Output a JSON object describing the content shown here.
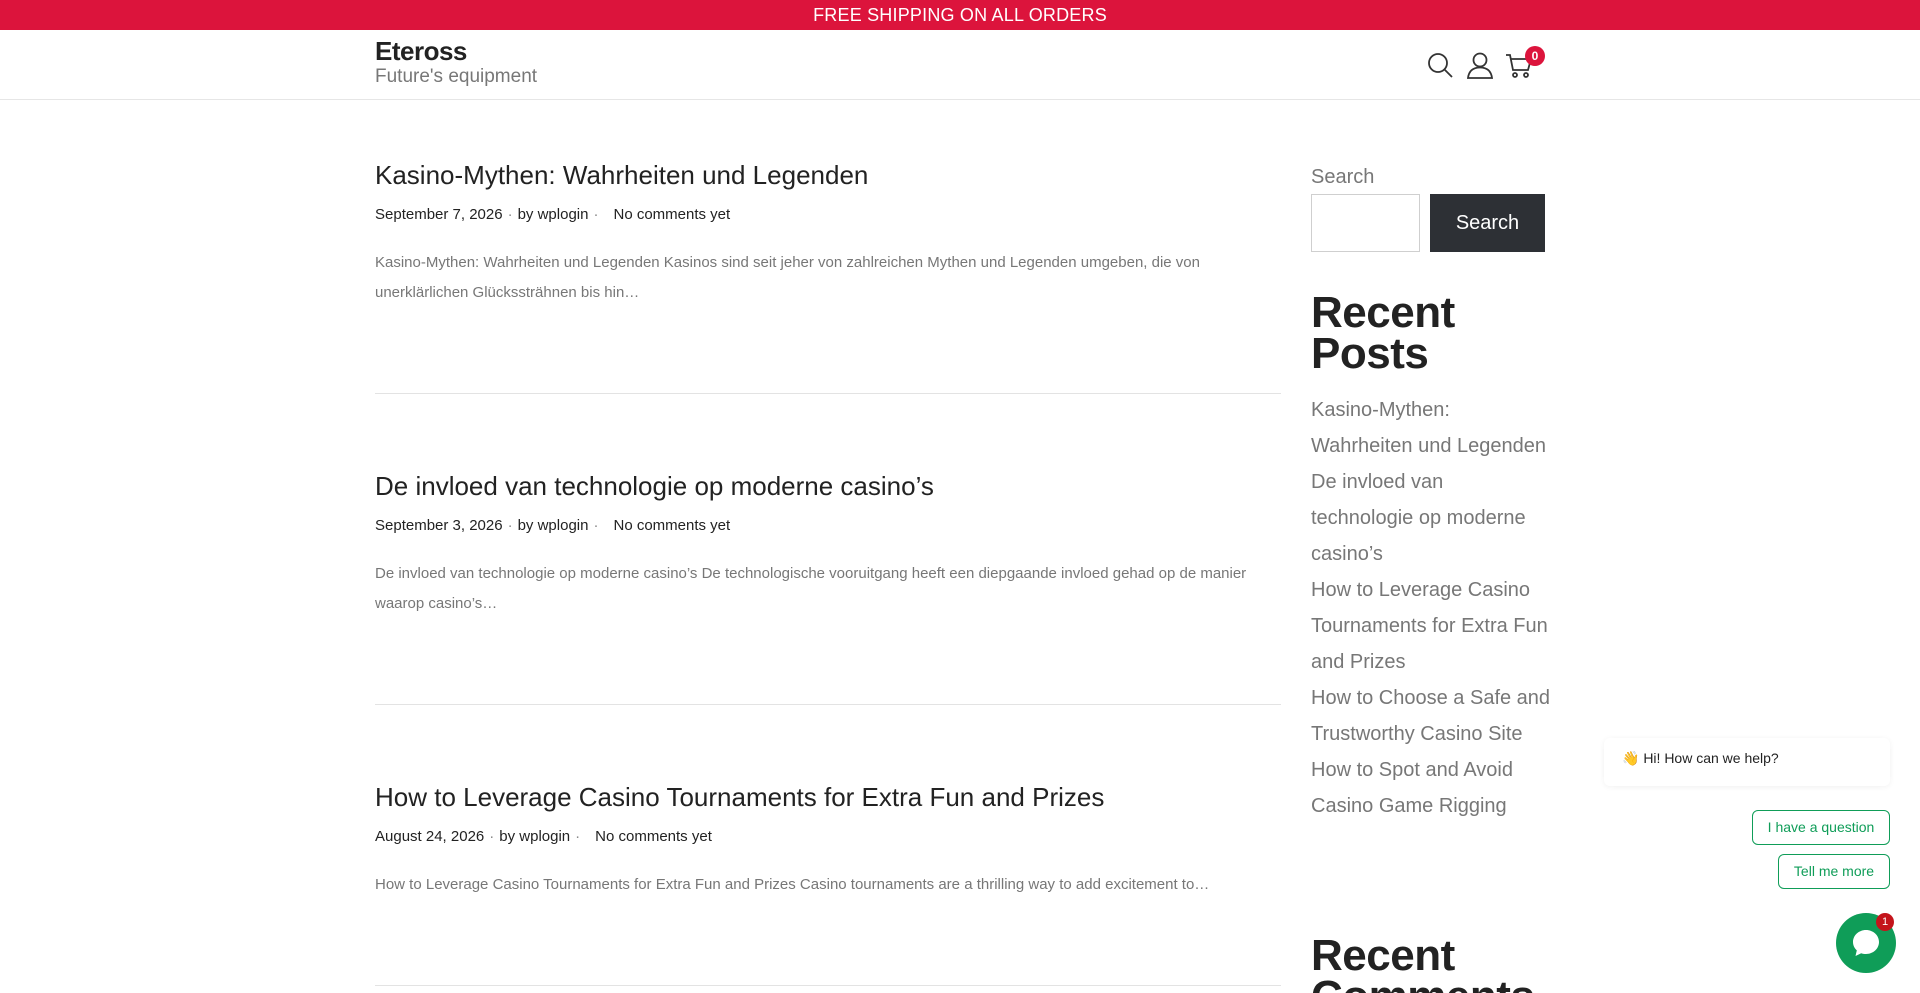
{
  "topbar": {
    "text": "FREE SHIPPING ON ALL ORDERS"
  },
  "header": {
    "site_title": "Eteross",
    "tagline": "Future's equipment",
    "icons": [
      "search-icon",
      "user-icon",
      "cart-icon"
    ],
    "cart_count": "0"
  },
  "posts": [
    {
      "title": "Kasino-Mythen: Wahrheiten und Legenden",
      "date": "September 7, 2026",
      "author": "by wplogin",
      "comments": "No comments yet",
      "excerpt": "Kasino-Mythen: Wahrheiten und Legenden Kasinos sind seit jeher von zahlreichen Mythen und Legenden umgeben, die von unerklärlichen Glückssträhnen bis hin…"
    },
    {
      "title": "De invloed van technologie op moderne casino’s",
      "date": "September 3, 2026",
      "author": "by wplogin",
      "comments": "No comments yet",
      "excerpt": "De invloed van technologie op moderne casino’s De technologische vooruitgang heeft een diepgaande invloed gehad op de manier waarop casino’s…"
    },
    {
      "title": "How to Leverage Casino Tournaments for Extra Fun and Prizes",
      "date": "August 24, 2026",
      "author": "by wplogin",
      "comments": "No comments yet",
      "excerpt": "How to Leverage Casino Tournaments for Extra Fun and Prizes Casino tournaments are a thrilling way to add excitement to…"
    }
  ],
  "meta_separator": "·",
  "sidebar": {
    "search_label": "Search",
    "search_button": "Search",
    "recent_posts_heading": "Recent Posts",
    "recent_posts": [
      "Kasino-Mythen: Wahrheiten und Legenden",
      "De invloed van technologie op moderne casino’s",
      "How to Leverage Casino Tournaments for Extra Fun and Prizes",
      "How to Choose a Safe and Trustworthy Casino Site",
      "How to Spot and Avoid Casino Game Rigging"
    ],
    "recent_comments_heading": "Recent Comments"
  },
  "chat": {
    "greeting": "👋 Hi! How can we help?",
    "option_1": "I have a question",
    "option_2": "Tell me more",
    "badge": "1",
    "color": "#0f9d58"
  },
  "colors": {
    "accent": "#dc143c",
    "button_dark": "#2d3035",
    "chat_green": "#0f9d58"
  }
}
